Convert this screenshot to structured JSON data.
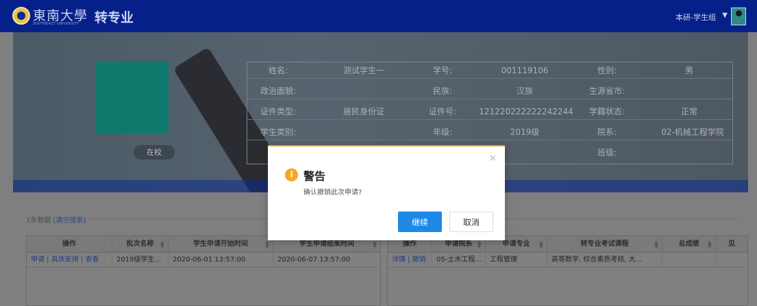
{
  "header": {
    "school_name": "東南大學",
    "school_name_en": "SOUTHEAST UNIVERSITY",
    "app_title": "转专业",
    "user_role": "本研-学生组",
    "role_caret": "▼"
  },
  "profile": {
    "status": "在校",
    "labels": {
      "name": "姓名:",
      "student_no": "学号:",
      "gender": "性别:",
      "politics": "政治面貌:",
      "ethnicity": "民族:",
      "origin": "生源省市:",
      "id_type": "证件类型:",
      "id_no": "证件号:",
      "enroll_status": "学籍状态:",
      "student_type": "学生类别:",
      "grade": "年级:",
      "department": "院系:",
      "class": "班级:"
    },
    "values": {
      "name": "测试学生一",
      "student_no": "001119106",
      "gender": "男",
      "politics": "",
      "ethnicity": "汉族",
      "origin": "",
      "id_type": "居民身份证",
      "id_no": "121220222222242244",
      "enroll_status": "正常",
      "student_type": "",
      "grade": "2019级",
      "department": "02-机械工程学院",
      "class": ""
    }
  },
  "list": {
    "count_text": "1条数据",
    "clear_search": "[清空搜索]"
  },
  "left_table": {
    "columns": [
      "操作",
      "批次名称",
      "学生申请开始时间",
      "学生申请结束时间"
    ],
    "rows": [
      {
        "actions": "申请 | 具体安排 | 查看",
        "batch": "2019级学生...",
        "start": "2020-06-01 13:57:00",
        "end": "2020-06-07 13:57:00"
      }
    ]
  },
  "right_table": {
    "columns": [
      "操作",
      "申请院系",
      "申请专业",
      "转专业考试课程",
      "总成绩",
      "见"
    ],
    "rows": [
      {
        "actions": "详情 | 撤销",
        "dept": "05-土木工程...",
        "major": "工程管理",
        "courses": "高等数学, 综合素质考核, 大...",
        "score": ""
      }
    ]
  },
  "modal": {
    "title": "警告",
    "message": "确认撤销此次申请?",
    "continue_label": "继续",
    "cancel_label": "取消",
    "close_glyph": "×",
    "icon_glyph": "i"
  },
  "colors": {
    "header_bg": "#06208a",
    "warning": "#f5a623",
    "primary": "#1e88e5"
  }
}
